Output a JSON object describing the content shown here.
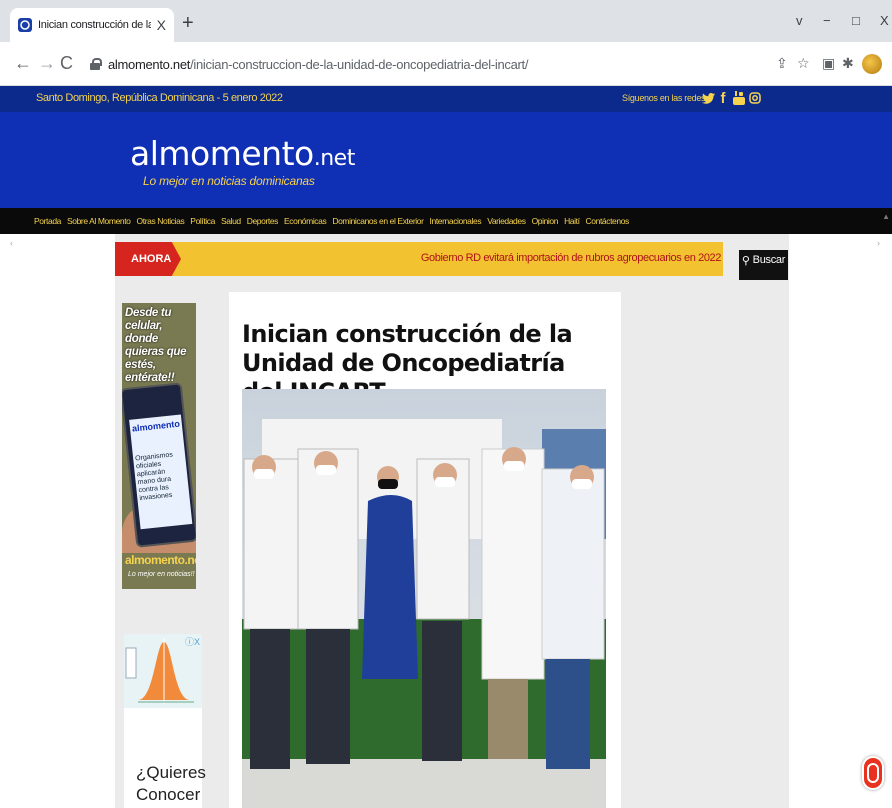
{
  "browser": {
    "tab_title": "Inician construcción de la Unidad",
    "tab_close": "X",
    "new_tab": "+",
    "url_host": "almomento.net",
    "url_path": "/inician-construccion-de-la-unidad-de-oncopediatria-del-incart/",
    "window_controls": [
      "v",
      "−",
      "□",
      "X"
    ],
    "icons": [
      "back-icon",
      "forward-icon",
      "reload-icon",
      "lock-icon",
      "share-icon",
      "star-icon",
      "extension-icon",
      "puzzle-icon",
      "profile-icon",
      "menu-icon"
    ]
  },
  "site": {
    "topbar": {
      "date": "Santo Domingo, República Dominicana - 5 enero 2022",
      "follow_label": "Síguenos en las redes:",
      "social": [
        "twitter-icon",
        "facebook-icon",
        "youtube-icon",
        "instagram-icon"
      ]
    },
    "logo": {
      "al": "al",
      "momento": "momento",
      "net": ".net",
      "tagline": "Lo mejor en noticias dominicanas"
    },
    "nav": [
      "Portada",
      "Sobre Al Momento",
      "Otras Noticias",
      "Política",
      "Salud",
      "Deportes",
      "Económicas",
      "Dominicanos en el Exterior",
      "Internacionales",
      "Variedades",
      "Opinion",
      "Haití",
      "Contáctenos"
    ],
    "ticker": {
      "label": "AHORA",
      "text": "Gobierno RD evitará importación de rubros agropecuarios en 2022"
    },
    "search_label": "Buscar",
    "ad1": {
      "text": "Desde tu celular, donde quieras que estés, entérate!!",
      "phone_brand": "almomento",
      "phone_headline": "Organismos oficiales aplicarán mano dura contra las invasiones",
      "brand": "almomento.net",
      "sub": "Lo mejor en noticias!!"
    },
    "ad2": {
      "question": "¿Quieres Conocer",
      "choices": "ⓘX"
    },
    "article": {
      "headline": "Inician construcción de la Unidad de Oncopediatría del INCART"
    }
  },
  "colors": {
    "topbar": "#0b2a8c",
    "masthead": "#0f2fb5",
    "accent_yellow": "#f5d34f",
    "ticker_red": "#d6241e",
    "ticker_bg": "#f2c230"
  }
}
